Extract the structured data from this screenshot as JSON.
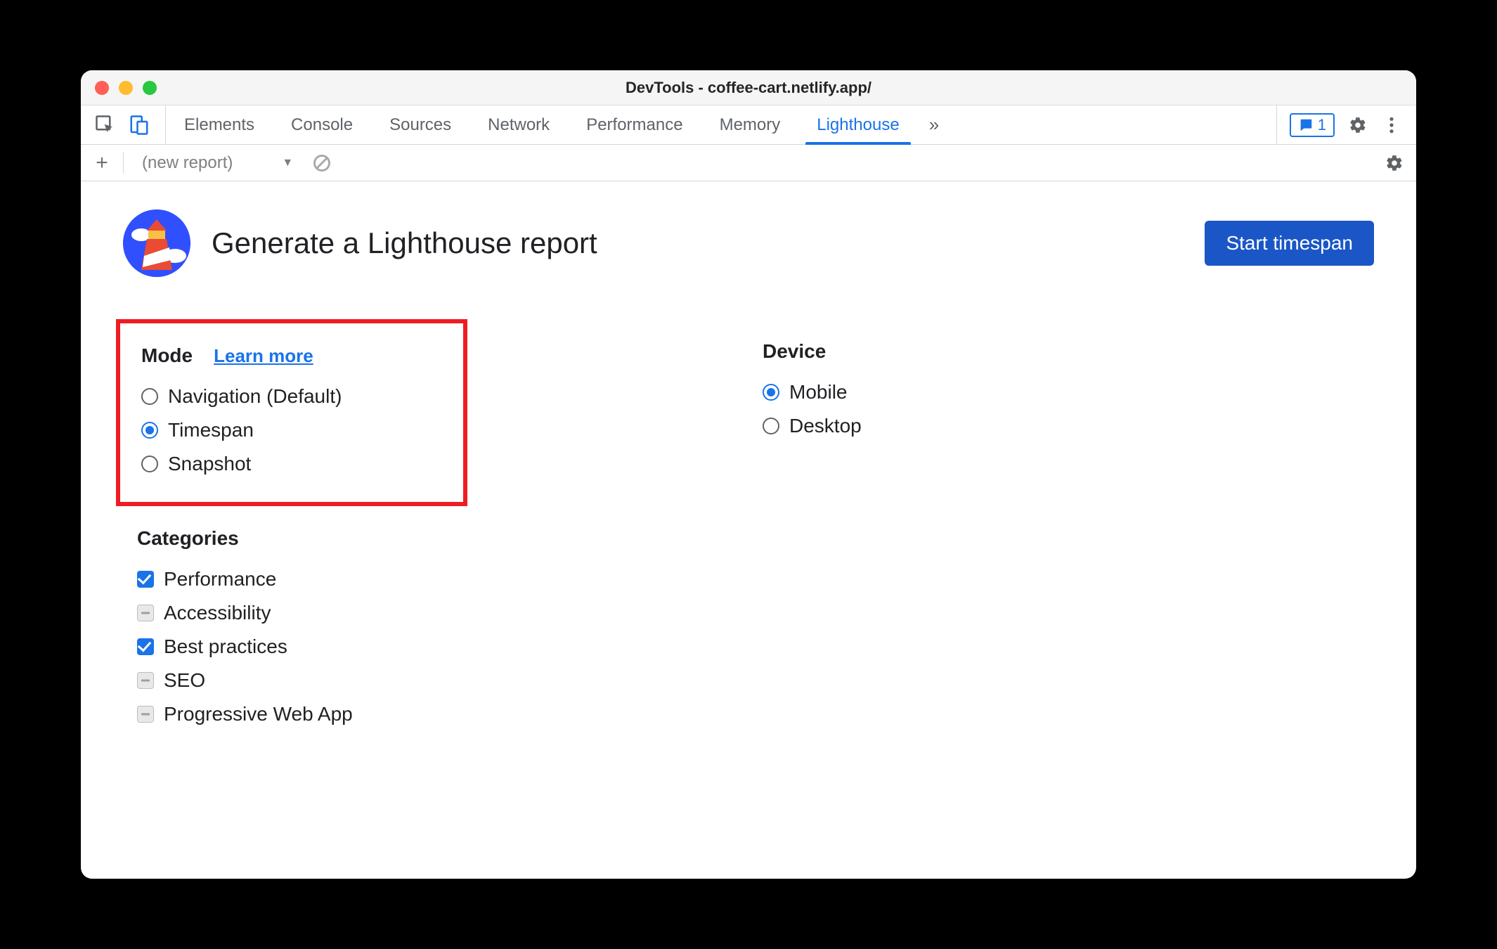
{
  "window": {
    "title": "DevTools - coffee-cart.netlify.app/"
  },
  "tabs": {
    "items": [
      "Elements",
      "Console",
      "Sources",
      "Network",
      "Performance",
      "Memory",
      "Lighthouse"
    ],
    "active_index": 6,
    "overflow_glyph": "»",
    "feedback_count": "1"
  },
  "toolbar": {
    "report_label": "(new report)"
  },
  "header": {
    "title": "Generate a Lighthouse report",
    "start_button": "Start timespan"
  },
  "mode": {
    "heading": "Mode",
    "learn_more": "Learn more",
    "options": [
      {
        "label": "Navigation (Default)",
        "selected": false
      },
      {
        "label": "Timespan",
        "selected": true
      },
      {
        "label": "Snapshot",
        "selected": false
      }
    ]
  },
  "device": {
    "heading": "Device",
    "options": [
      {
        "label": "Mobile",
        "selected": true
      },
      {
        "label": "Desktop",
        "selected": false
      }
    ]
  },
  "categories": {
    "heading": "Categories",
    "items": [
      {
        "label": "Performance",
        "state": "checked"
      },
      {
        "label": "Accessibility",
        "state": "mixed"
      },
      {
        "label": "Best practices",
        "state": "checked"
      },
      {
        "label": "SEO",
        "state": "mixed"
      },
      {
        "label": "Progressive Web App",
        "state": "mixed"
      }
    ]
  },
  "highlight_box": "mode"
}
